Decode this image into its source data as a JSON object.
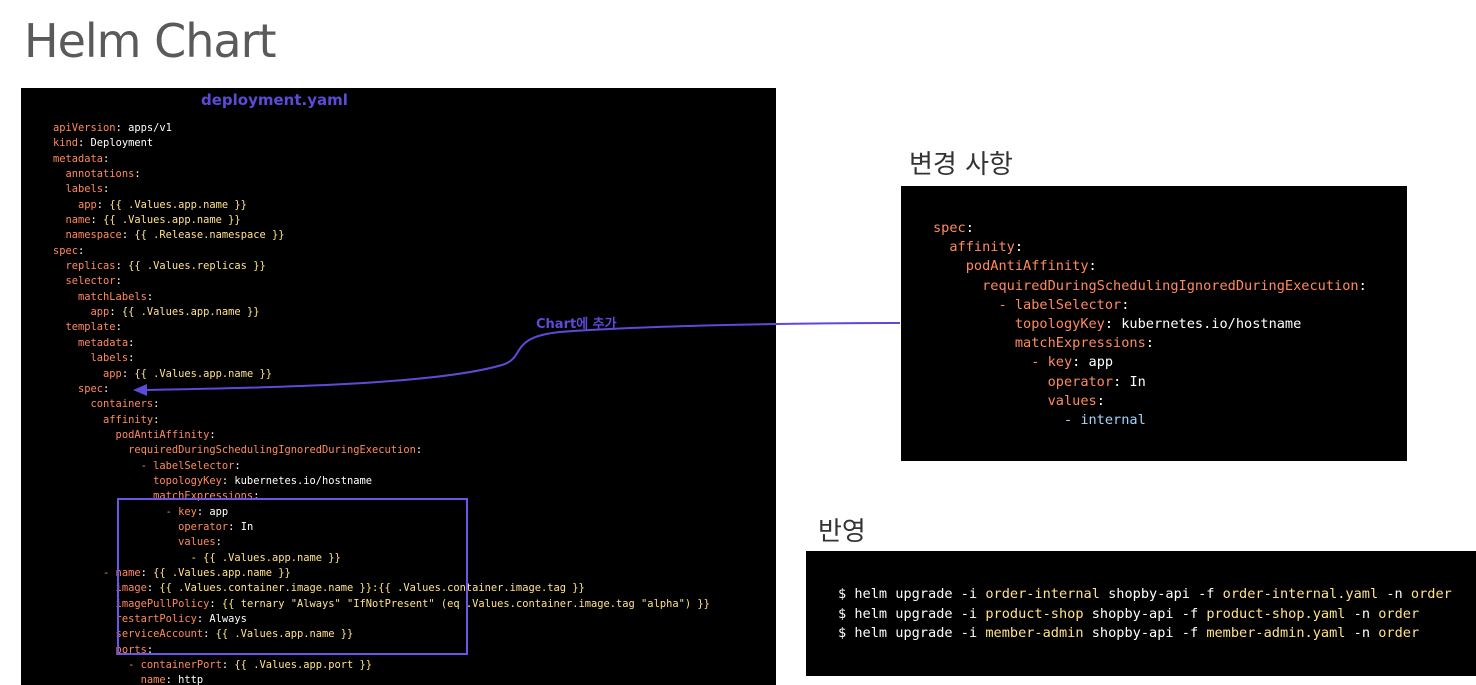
{
  "slide": {
    "title": "Helm Chart"
  },
  "main": {
    "file_title": "deployment.yaml",
    "lines": [
      [
        [
          "k",
          "apiVersion"
        ],
        [
          "",
          "apps/v1"
        ]
      ],
      [
        [
          "k",
          "kind"
        ],
        [
          "",
          "Deployment"
        ]
      ],
      [
        [
          "k",
          "metadata"
        ]
      ],
      [
        [
          "k",
          "  annotations"
        ]
      ],
      [
        [
          "k",
          "  labels"
        ]
      ],
      [
        [
          "k",
          "    app"
        ],
        [
          "s",
          "{{ .Values.app.name }}"
        ]
      ],
      [
        [
          "k",
          "  name"
        ],
        [
          "s",
          "{{ .Values.app.name }}"
        ]
      ],
      [
        [
          "k",
          "  namespace"
        ],
        [
          "s",
          "{{ .Release.namespace }}"
        ]
      ],
      [
        [
          "k",
          "spec"
        ]
      ],
      [
        [
          "k",
          "  replicas"
        ],
        [
          "s",
          "{{ .Values.replicas }}"
        ]
      ],
      [
        [
          "k",
          "  selector"
        ]
      ],
      [
        [
          "k",
          "    matchLabels"
        ]
      ],
      [
        [
          "k",
          "      app"
        ],
        [
          "s",
          "{{ .Values.app.name }}"
        ]
      ],
      [
        [
          "k",
          "  template"
        ]
      ],
      [
        [
          "k",
          "    metadata"
        ]
      ],
      [
        [
          "k",
          "      labels"
        ]
      ],
      [
        [
          "k",
          "        app"
        ],
        [
          "s",
          "{{ .Values.app.name }}"
        ]
      ],
      [
        [
          "k",
          "    spec"
        ]
      ],
      [
        [
          "k",
          "      containers"
        ]
      ],
      [
        [
          "k",
          "        affinity"
        ]
      ],
      [
        [
          "k",
          "          podAntiAffinity"
        ]
      ],
      [
        [
          "k",
          "            requiredDuringSchedulingIgnoredDuringExecution"
        ]
      ],
      [
        [
          "k",
          "              - labelSelector"
        ]
      ],
      [
        [
          "k",
          "                topologyKey"
        ],
        [
          "",
          "kubernetes.io/hostname"
        ]
      ],
      [
        [
          "k",
          "                matchExpressions"
        ]
      ],
      [
        [
          "k",
          "                  - key"
        ],
        [
          "",
          "app"
        ]
      ],
      [
        [
          "k",
          "                    operator"
        ],
        [
          "",
          "In"
        ]
      ],
      [
        [
          "k",
          "                    values"
        ]
      ],
      [
        [
          "s",
          "                      - {{ .Values.app.name }}"
        ]
      ],
      [
        [
          "k",
          "        - name"
        ],
        [
          "s",
          "{{ .Values.app.name }}"
        ]
      ],
      [
        [
          "k",
          "          image"
        ],
        [
          "s",
          "{{ .Values.container.image.name }}:{{ .Values.container.image.tag }}"
        ]
      ],
      [
        [
          "k",
          "          imagePullPolicy"
        ],
        [
          "s",
          "{{ ternary \"Always\" \"IfNotPresent\" (eq .Values.container.image.tag \"alpha\") }}"
        ]
      ],
      [
        [
          "k",
          "          restartPolicy"
        ],
        [
          "",
          "Always"
        ]
      ],
      [
        [
          "k",
          "          serviceAccount"
        ],
        [
          "s",
          "{{ .Values.app.name }}"
        ]
      ],
      [
        [
          "k",
          "          ports"
        ]
      ],
      [
        [
          "k",
          "            - containerPort"
        ],
        [
          "s",
          "{{ .Values.app.port }}"
        ]
      ],
      [
        [
          "k",
          "              name"
        ],
        [
          "",
          "http"
        ]
      ]
    ]
  },
  "arrow": {
    "label": "Chart에 추가"
  },
  "changes": {
    "title": "변경 사항",
    "lines": [
      [
        [
          "k",
          "spec"
        ]
      ],
      [
        [
          "k",
          "  affinity"
        ]
      ],
      [
        [
          "k",
          "    podAntiAffinity"
        ]
      ],
      [
        [
          "k",
          "      requiredDuringSchedulingIgnoredDuringExecution"
        ]
      ],
      [
        [
          "k",
          "        - labelSelector"
        ]
      ],
      [
        [
          "k",
          "          topologyKey"
        ],
        [
          "",
          "kubernetes.io/hostname"
        ]
      ],
      [
        [
          "k",
          "          matchExpressions"
        ]
      ],
      [
        [
          "k",
          "            - key"
        ],
        [
          "",
          "app"
        ]
      ],
      [
        [
          "k",
          "              operator"
        ],
        [
          "",
          "In"
        ]
      ],
      [
        [
          "k",
          "              values"
        ]
      ],
      [
        [
          "c",
          "                - internal"
        ]
      ]
    ]
  },
  "apply": {
    "title": "반영",
    "commands": [
      {
        "prompt": "$ helm upgrade -i ",
        "release": "order-internal",
        "chart": " shopby-api -f ",
        "values": "order-internal.yaml",
        "ns": " -n ",
        "namespace": "order"
      },
      {
        "prompt": "$ helm upgrade -i ",
        "release": "product-shop",
        "chart": " shopby-api -f ",
        "values": "product-shop.yaml",
        "ns": " -n ",
        "namespace": "order"
      },
      {
        "prompt": "$ helm upgrade -i ",
        "release": "member-admin",
        "chart": " shopby-api -f ",
        "values": "member-admin.yaml",
        "ns": " -n ",
        "namespace": "order"
      }
    ]
  },
  "colors": {
    "key": "#ff8a5c",
    "string": "#ffe28a",
    "accent": "#5b4bd6",
    "panel": "#000000"
  }
}
